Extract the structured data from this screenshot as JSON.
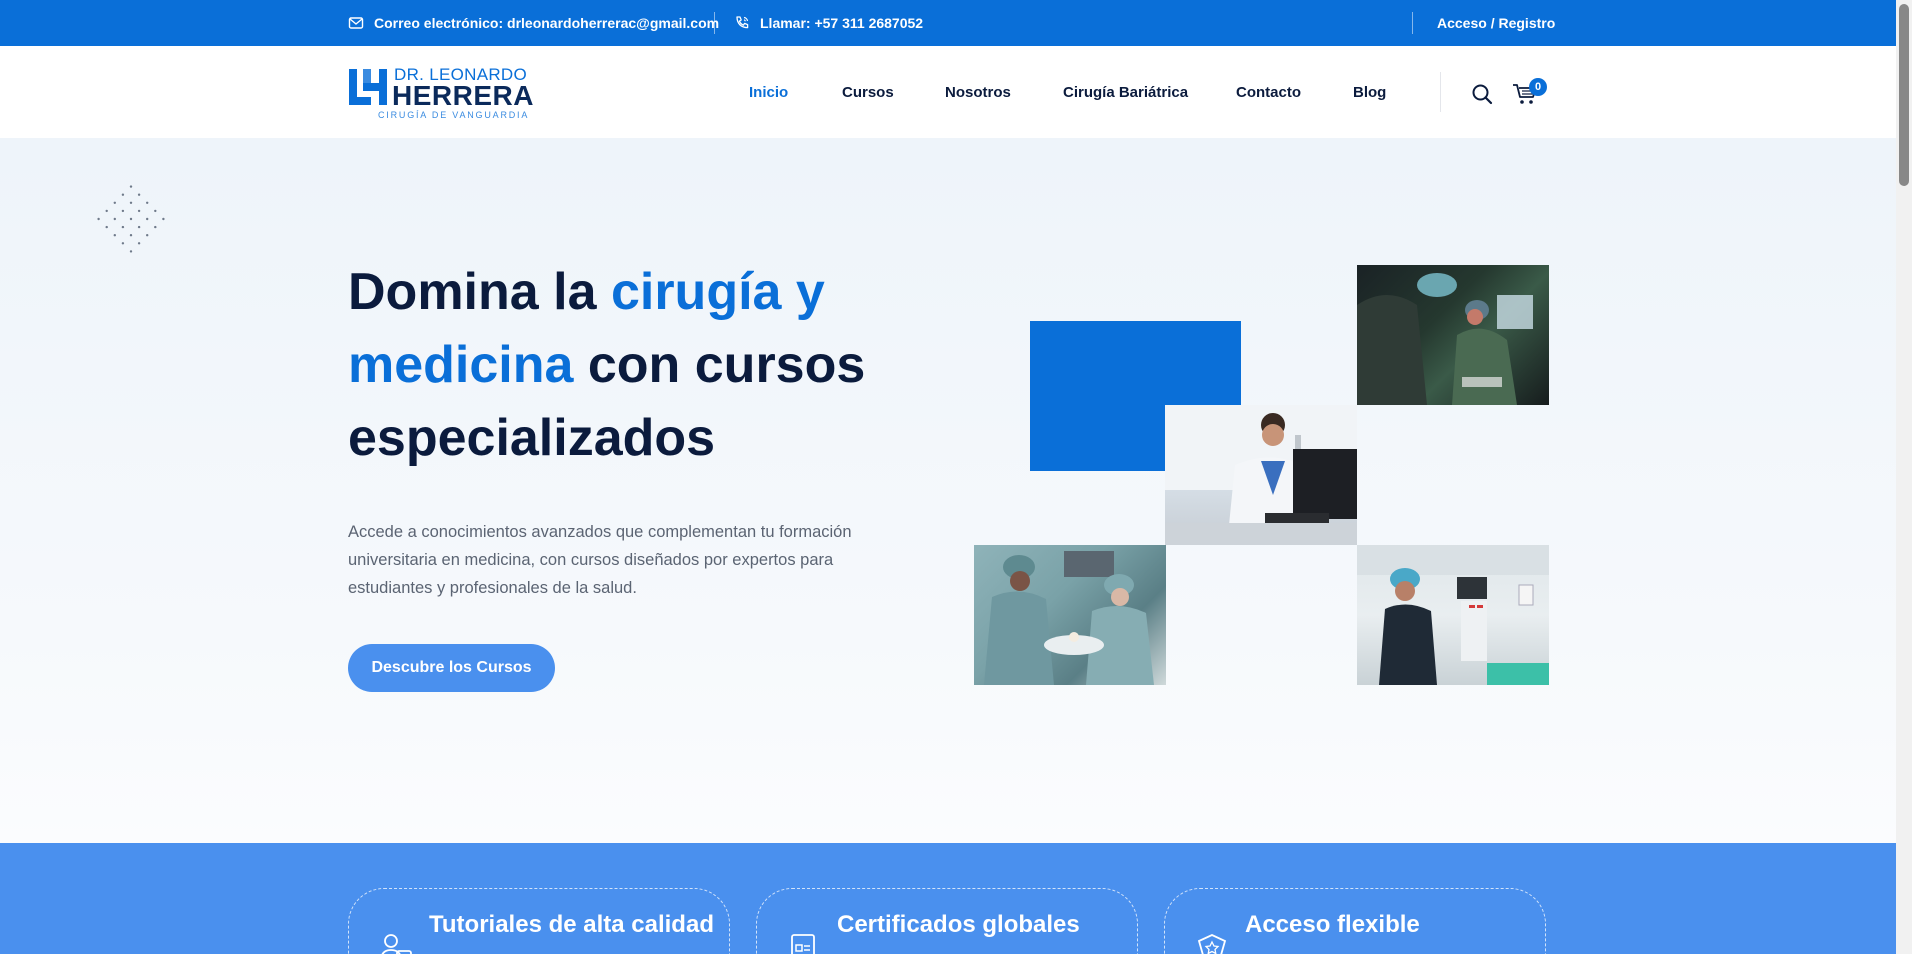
{
  "topbar": {
    "email_label": "Correo electrónico: drleonardoherrerac@gmail.com",
    "phone_label": "Llamar: +57 311 2687052",
    "login_label": "Acceso / Registro"
  },
  "logo": {
    "line1": "DR. LEONARDO",
    "line2": "HERRERA",
    "tagline": "CIRUGÍA DE VANGUARDIA"
  },
  "nav": {
    "items": [
      {
        "label": "Inicio",
        "active": true
      },
      {
        "label": "Cursos"
      },
      {
        "label": "Nosotros"
      },
      {
        "label": "Cirugía Bariátrica"
      },
      {
        "label": "Contacto"
      },
      {
        "label": "Blog"
      }
    ]
  },
  "cart": {
    "count": "0"
  },
  "hero": {
    "title_part1": "Domina la ",
    "title_highlight": "cirugía y medicina",
    "title_part2": " con cursos especializados",
    "description": "Accede a conocimientos avanzados que complementan tu formación universitaria en medicina, con cursos diseñados por expertos para estudiantes y profesionales de la salud.",
    "cta_label": "Descubre los Cursos"
  },
  "features": [
    {
      "title": "Tutoriales de alta calidad",
      "icon": "video-tutorial-icon"
    },
    {
      "title": "Certificados globales",
      "icon": "certificate-icon"
    },
    {
      "title": "Acceso flexible",
      "icon": "award-icon"
    }
  ],
  "colors": {
    "primary": "#0a6fd8",
    "navy": "#0b1b3d",
    "button": "#4a90ee"
  }
}
